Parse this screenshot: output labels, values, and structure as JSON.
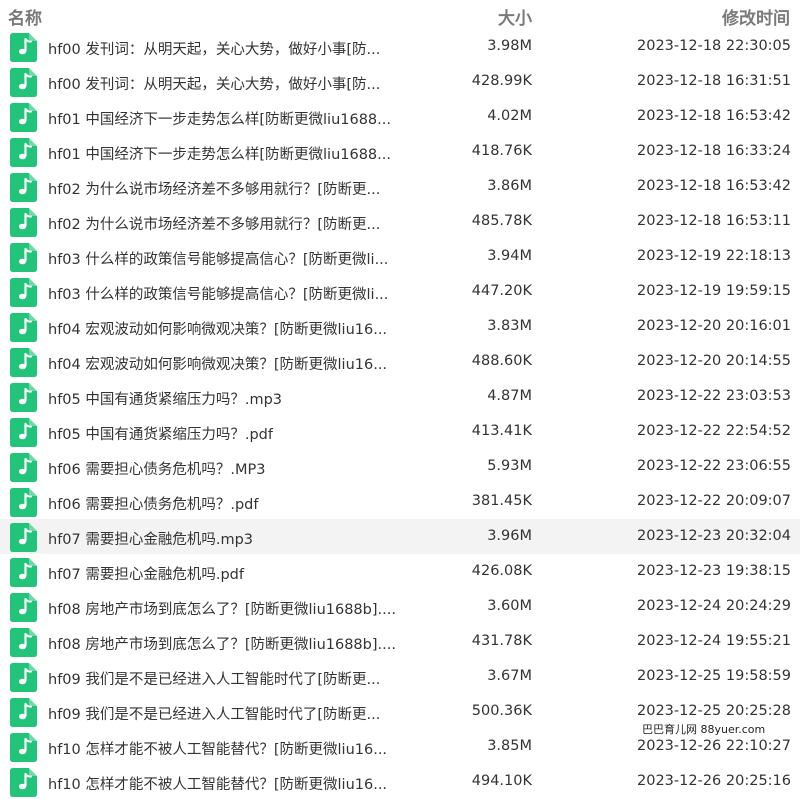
{
  "header": {
    "name": "名称",
    "size": "大小",
    "modified": "修改时间"
  },
  "files": [
    {
      "name": "hf00 发刊词：从明天起，关心大势，做好小事[防...",
      "size": "3.98M",
      "modified": "2023-12-18 22:30:05"
    },
    {
      "name": "hf00 发刊词：从明天起，关心大势，做好小事[防...",
      "size": "428.99K",
      "modified": "2023-12-18 16:31:51"
    },
    {
      "name": "hf01 中国经济下一步走势怎么样[防断更微liu1688...",
      "size": "4.02M",
      "modified": "2023-12-18 16:53:42"
    },
    {
      "name": "hf01 中国经济下一步走势怎么样[防断更微liu1688...",
      "size": "418.76K",
      "modified": "2023-12-18 16:33:24"
    },
    {
      "name": "hf02 为什么说市场经济差不多够用就行？[防断更...",
      "size": "3.86M",
      "modified": "2023-12-18 16:53:42"
    },
    {
      "name": "hf02 为什么说市场经济差不多够用就行？[防断更...",
      "size": "485.78K",
      "modified": "2023-12-18 16:53:11"
    },
    {
      "name": "hf03 什么样的政策信号能够提高信心？[防断更微li...",
      "size": "3.94M",
      "modified": "2023-12-19 22:18:13"
    },
    {
      "name": "hf03 什么样的政策信号能够提高信心？[防断更微li...",
      "size": "447.20K",
      "modified": "2023-12-19 19:59:15"
    },
    {
      "name": "hf04 宏观波动如何影响微观决策？[防断更微liu16...",
      "size": "3.83M",
      "modified": "2023-12-20 20:16:01"
    },
    {
      "name": "hf04 宏观波动如何影响微观决策？[防断更微liu16...",
      "size": "488.60K",
      "modified": "2023-12-20 20:14:55"
    },
    {
      "name": "hf05 中国有通货紧缩压力吗？.mp3",
      "size": "4.87M",
      "modified": "2023-12-22 23:03:53"
    },
    {
      "name": "hf05 中国有通货紧缩压力吗？.pdf",
      "size": "413.41K",
      "modified": "2023-12-22 22:54:52"
    },
    {
      "name": "hf06 需要担心债务危机吗？.MP3",
      "size": "5.93M",
      "modified": "2023-12-22 23:06:55"
    },
    {
      "name": "hf06 需要担心债务危机吗？.pdf",
      "size": "381.45K",
      "modified": "2023-12-22 20:09:07"
    },
    {
      "name": "hf07 需要担心金融危机吗.mp3",
      "size": "3.96M",
      "modified": "2023-12-23 20:32:04"
    },
    {
      "name": "hf07 需要担心金融危机吗.pdf",
      "size": "426.08K",
      "modified": "2023-12-23 19:38:15"
    },
    {
      "name": "hf08 房地产市场到底怎么了？[防断更微liu1688b]....",
      "size": "3.60M",
      "modified": "2023-12-24 20:24:29"
    },
    {
      "name": "hf08 房地产市场到底怎么了？[防断更微liu1688b]....",
      "size": "431.78K",
      "modified": "2023-12-24 19:55:21"
    },
    {
      "name": "hf09 我们是不是已经进入人工智能时代了[防断更...",
      "size": "3.67M",
      "modified": "2023-12-25 19:58:59"
    },
    {
      "name": "hf09 我们是不是已经进入人工智能时代了[防断更...",
      "size": "500.36K",
      "modified": "2023-12-25 20:25:28"
    },
    {
      "name": "hf10 怎样才能不被人工智能替代？[防断更微liu16...",
      "size": "3.85M",
      "modified": "2023-12-26 22:10:27"
    },
    {
      "name": "hf10 怎样才能不被人工智能替代？[防断更微liu16...",
      "size": "494.10K",
      "modified": "2023-12-26 20:25:16"
    }
  ],
  "highlighted_row": 14,
  "watermark": "巴巴育儿网 88yuer.com",
  "colors": {
    "icon_green": "#22c47a",
    "header_text": "#7a7a7a",
    "row_highlight": "#f3f3f3"
  },
  "icon": "file-music-note-icon"
}
